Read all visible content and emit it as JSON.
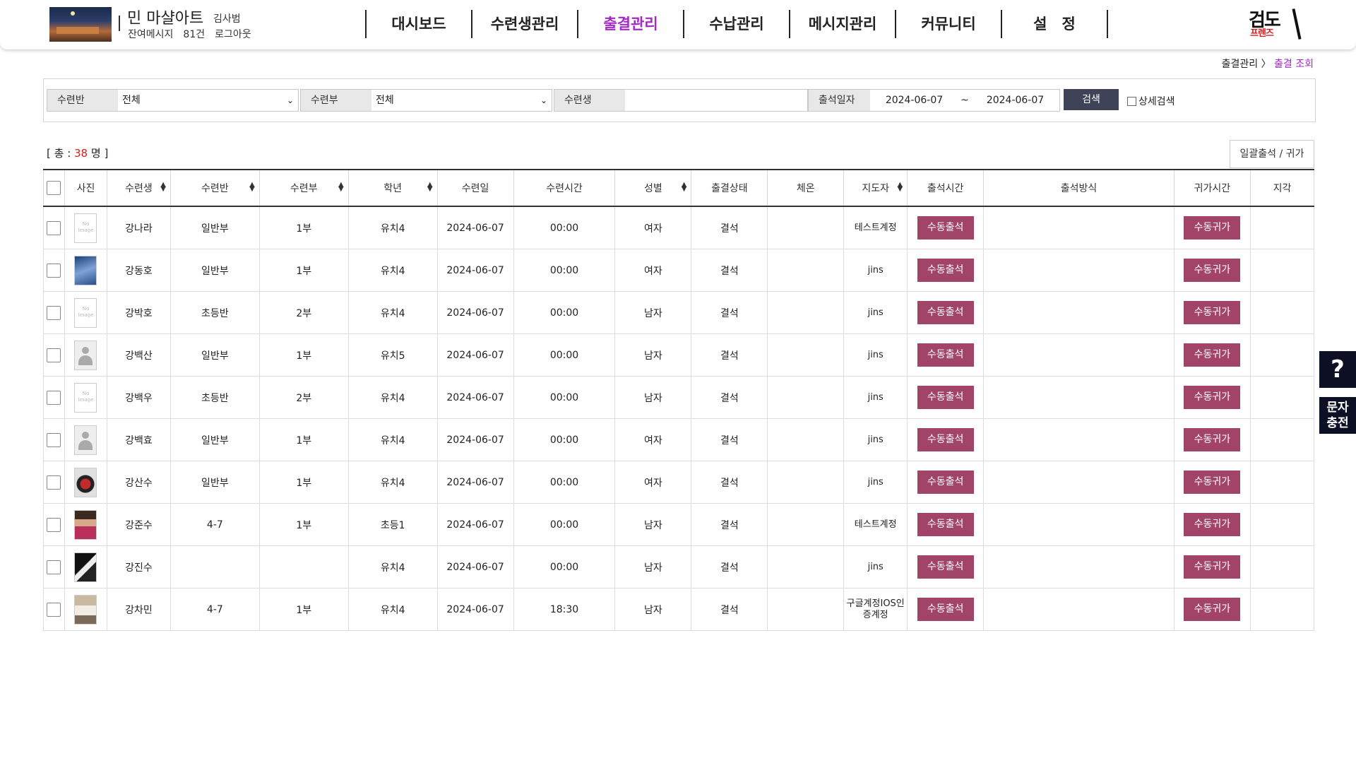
{
  "header": {
    "brand_name": "민 마샬아트",
    "brand_user": "김사범",
    "messages_label": "잔여메시지",
    "messages_count": "81건",
    "logout": "로그아웃",
    "nav": [
      "대시보드",
      "수련생관리",
      "출결관리",
      "수납관리",
      "메시지관리",
      "커뮤니티",
      "설　정"
    ],
    "active_nav": "출결관리",
    "logo_main": "검도",
    "logo_sub": "프렌즈"
  },
  "breadcrumb": {
    "parent": "출결관리",
    "sep": "〉",
    "current": "출결 조회"
  },
  "filter": {
    "class_label": "수련반",
    "class_value": "전체",
    "part_label": "수련부",
    "part_value": "전체",
    "student_label": "수련생",
    "student_value": "",
    "date_label": "출석일자",
    "date_from": "2024-06-07",
    "date_tilde": "~",
    "date_to": "2024-06-07",
    "search_button": "검색",
    "advanced_label": "상세검색"
  },
  "summary": {
    "prefix": "[ 총 : ",
    "count": "38",
    "suffix": " 명 ]"
  },
  "bulk_button": "일괄출석 / 귀가",
  "table": {
    "headers": [
      "사진",
      "수련생",
      "수련반",
      "수련부",
      "학년",
      "수련일",
      "수련시간",
      "성별",
      "출결상태",
      "체온",
      "지도자",
      "출석시간",
      "출석방식",
      "귀가시간",
      "지각"
    ],
    "checkin_label": "수동출석",
    "checkout_label": "수동귀가",
    "rows": [
      {
        "photo": "noimg",
        "name": "강나라",
        "class": "일반부",
        "part": "1부",
        "grade": "유치4",
        "date": "2024-06-07",
        "time": "00:00",
        "gender": "여자",
        "status": "결석",
        "temp": "",
        "coach": "테스트계정"
      },
      {
        "photo": "photo1",
        "name": "강동호",
        "class": "일반부",
        "part": "1부",
        "grade": "유치4",
        "date": "2024-06-07",
        "time": "00:00",
        "gender": "여자",
        "status": "결석",
        "temp": "",
        "coach": "jins"
      },
      {
        "photo": "noimg",
        "name": "강박호",
        "class": "초등반",
        "part": "2부",
        "grade": "유치4",
        "date": "2024-06-07",
        "time": "00:00",
        "gender": "남자",
        "status": "결석",
        "temp": "",
        "coach": "jins"
      },
      {
        "photo": "person",
        "name": "강백산",
        "class": "일반부",
        "part": "1부",
        "grade": "유치5",
        "date": "2024-06-07",
        "time": "00:00",
        "gender": "남자",
        "status": "결석",
        "temp": "",
        "coach": "jins"
      },
      {
        "photo": "noimg",
        "name": "강백우",
        "class": "초등반",
        "part": "2부",
        "grade": "유치4",
        "date": "2024-06-07",
        "time": "00:00",
        "gender": "남자",
        "status": "결석",
        "temp": "",
        "coach": "jins"
      },
      {
        "photo": "person",
        "name": "강백효",
        "class": "일반부",
        "part": "1부",
        "grade": "유치4",
        "date": "2024-06-07",
        "time": "00:00",
        "gender": "여자",
        "status": "결석",
        "temp": "",
        "coach": "jins"
      },
      {
        "photo": "photo2",
        "name": "강산수",
        "class": "일반부",
        "part": "1부",
        "grade": "유치4",
        "date": "2024-06-07",
        "time": "00:00",
        "gender": "여자",
        "status": "결석",
        "temp": "",
        "coach": "jins"
      },
      {
        "photo": "photo3",
        "name": "강준수",
        "class": "4-7",
        "part": "1부",
        "grade": "초등1",
        "date": "2024-06-07",
        "time": "00:00",
        "gender": "남자",
        "status": "결석",
        "temp": "",
        "coach": "테스트계정"
      },
      {
        "photo": "photo4",
        "name": "강진수",
        "class": "",
        "part": "",
        "grade": "유치4",
        "date": "2024-06-07",
        "time": "00:00",
        "gender": "남자",
        "status": "결석",
        "temp": "",
        "coach": "jins"
      },
      {
        "photo": "photo5",
        "name": "강차민",
        "class": "4-7",
        "part": "1부",
        "grade": "유치4",
        "date": "2024-06-07",
        "time": "18:30",
        "gender": "남자",
        "status": "결석",
        "temp": "",
        "coach": "구글계정IOS인증계정"
      }
    ]
  },
  "side": {
    "help": "?",
    "sms_line1": "문자",
    "sms_line2": "충전"
  }
}
